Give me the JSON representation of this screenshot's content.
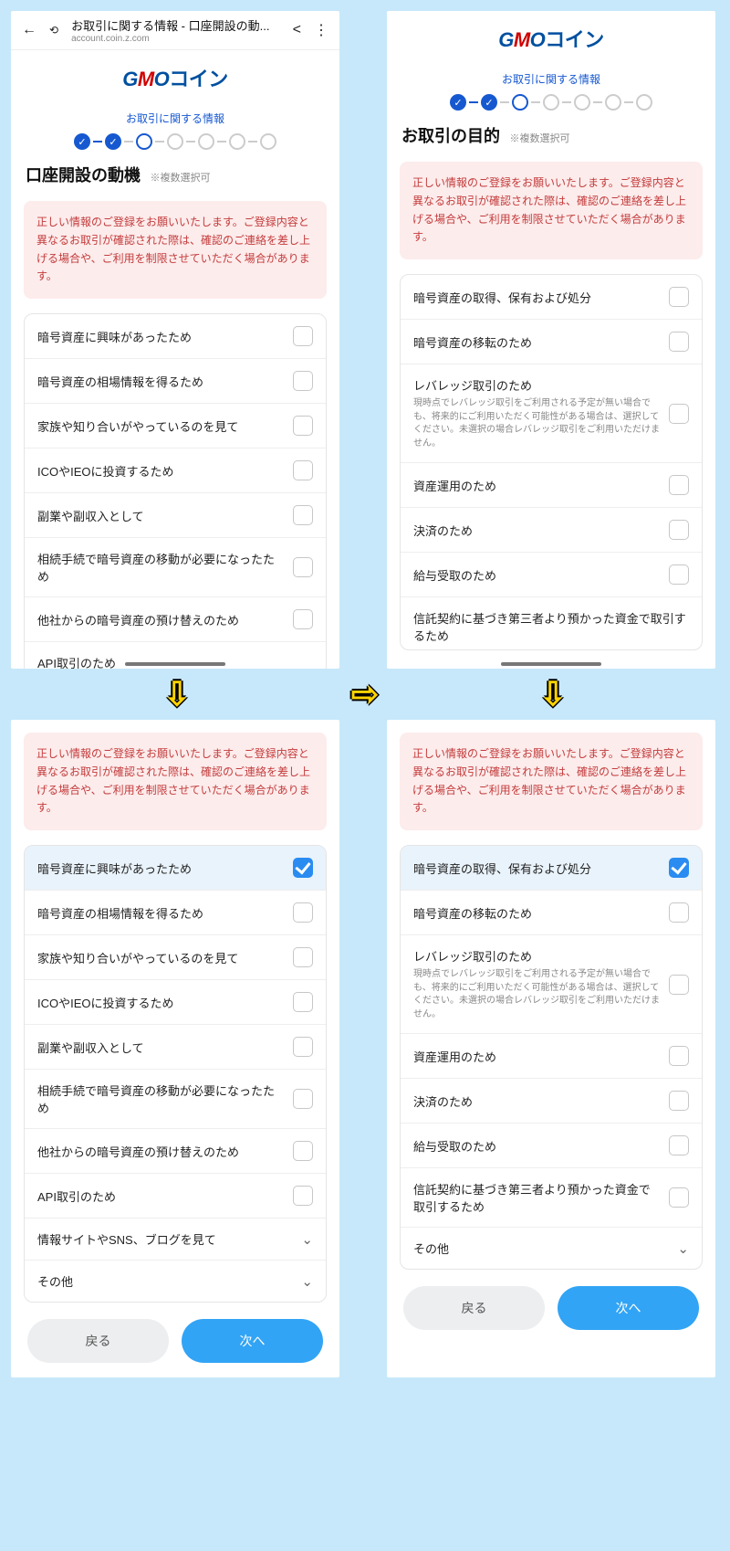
{
  "browser": {
    "title": "お取引に関する情報 - 口座開設の動...",
    "url": "account.coin.z.com"
  },
  "logo": {
    "g": "G",
    "m": "M",
    "o": "O",
    "coin": "コイン"
  },
  "stepLabel": "お取引に関する情報",
  "screen1": {
    "heading": "口座開設の動機",
    "sub": "※複数選択可",
    "warning": "正しい情報のご登録をお願いいたします。ご登録内容と異なるお取引が確認された際は、確認のご連絡を差し上げる場合や、ご利用を制限させていただく場合があります。",
    "items": [
      "暗号資産に興味があったため",
      "暗号資産の相場情報を得るため",
      "家族や知り合いがやっているのを見て",
      "ICOやIEOに投資するため",
      "副業や副収入として",
      "相続手続で暗号資産の移動が必要になったため",
      "他社からの暗号資産の預け替えのため"
    ],
    "cutoff": "API取引のため"
  },
  "screen2": {
    "heading": "お取引の目的",
    "sub": "※複数選択可",
    "warning": "正しい情報のご登録をお願いいたします。ご登録内容と異なるお取引が確認された際は、確認のご連絡を差し上げる場合や、ご利用を制限させていただく場合があります。",
    "items": [
      {
        "label": "暗号資産の取得、保有および処分"
      },
      {
        "label": "暗号資産の移転のため"
      },
      {
        "label": "レバレッジ取引のため",
        "note": "現時点でレバレッジ取引をご利用される予定が無い場合でも、将来的にご利用いただく可能性がある場合は、選択してください。未選択の場合レバレッジ取引をご利用いただけません。"
      },
      {
        "label": "資産運用のため"
      },
      {
        "label": "決済のため"
      },
      {
        "label": "給与受取のため"
      },
      {
        "label": "信託契約に基づき第三者より預かった資金で取引するため"
      }
    ]
  },
  "screen3": {
    "warning": "正しい情報のご登録をお願いいたします。ご登録内容と異なるお取引が確認された際は、確認のご連絡を差し上げる場合や、ご利用を制限させていただく場合があります。",
    "items": [
      "暗号資産に興味があったため",
      "暗号資産の相場情報を得るため",
      "家族や知り合いがやっているのを見て",
      "ICOやIEOに投資するため",
      "副業や副収入として",
      "相続手続で暗号資産の移動が必要になったため",
      "他社からの暗号資産の預け替えのため",
      "API取引のため"
    ],
    "expanders": [
      "情報サイトやSNS、ブログを見て",
      "その他"
    ],
    "back": "戻る",
    "next": "次へ"
  },
  "screen4": {
    "warning": "正しい情報のご登録をお願いいたします。ご登録内容と異なるお取引が確認された際は、確認のご連絡を差し上げる場合や、ご利用を制限させていただく場合があります。",
    "items": [
      {
        "label": "暗号資産の取得、保有および処分"
      },
      {
        "label": "暗号資産の移転のため"
      },
      {
        "label": "レバレッジ取引のため",
        "note": "現時点でレバレッジ取引をご利用される予定が無い場合でも、将来的にご利用いただく可能性がある場合は、選択してください。未選択の場合レバレッジ取引をご利用いただけません。"
      },
      {
        "label": "資産運用のため"
      },
      {
        "label": "決済のため"
      },
      {
        "label": "給与受取のため"
      },
      {
        "label": "信託契約に基づき第三者より預かった資金で取引するため"
      }
    ],
    "other": "その他",
    "back": "戻る",
    "next": "次へ"
  }
}
